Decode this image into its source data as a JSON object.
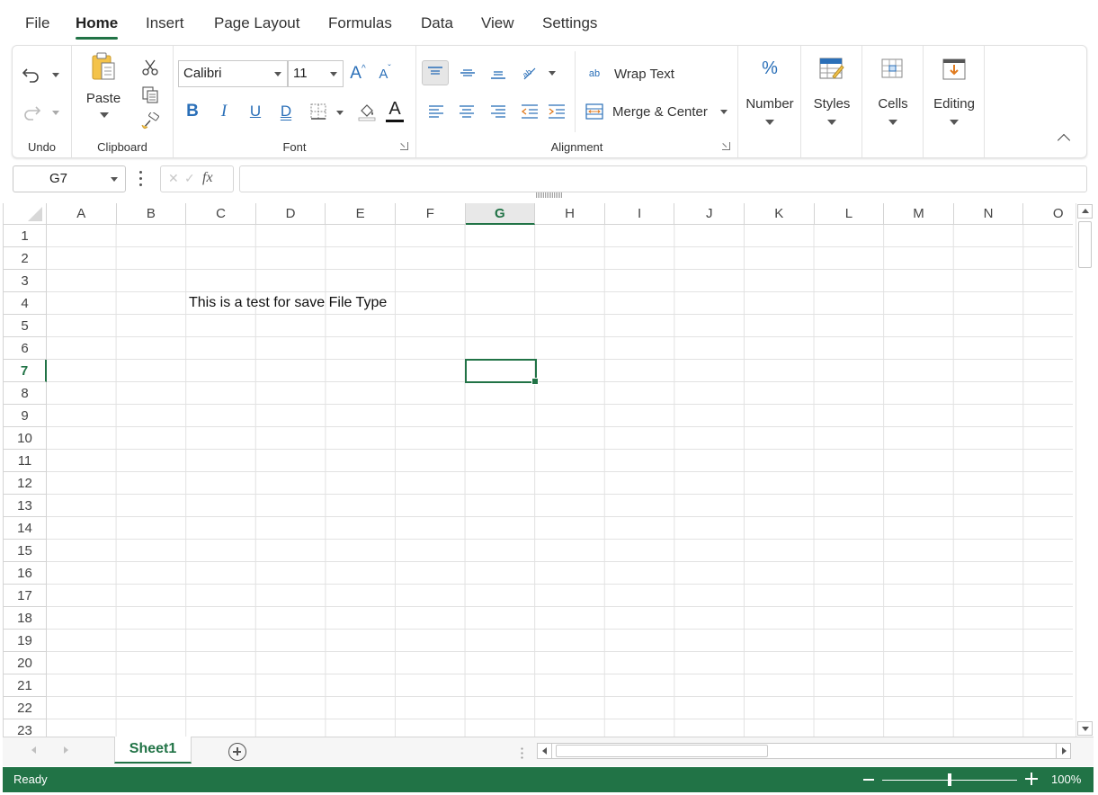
{
  "tabs": [
    {
      "label": "File"
    },
    {
      "label": "Home",
      "active": true
    },
    {
      "label": "Insert"
    },
    {
      "label": "Page Layout"
    },
    {
      "label": "Formulas"
    },
    {
      "label": "Data"
    },
    {
      "label": "View"
    },
    {
      "label": "Settings"
    }
  ],
  "ribbon": {
    "undo_group": {
      "label": "Undo"
    },
    "clipboard": {
      "label": "Clipboard",
      "paste_label": "Paste"
    },
    "font": {
      "label": "Font",
      "family": "Calibri",
      "size": "11",
      "bold_glyph": "B",
      "italic_glyph": "I",
      "underline_glyph": "U",
      "double_underline_glyph": "D",
      "font_color_glyph": "A",
      "grow_glyph": "A",
      "shrink_glyph": "A"
    },
    "alignment": {
      "label": "Alignment",
      "wrap_text": "Wrap Text",
      "merge_center": "Merge & Center",
      "wrap_icon_glyph": "ab"
    },
    "number": {
      "label": "Number",
      "icon_glyph": "%"
    },
    "styles": {
      "label": "Styles"
    },
    "cells": {
      "label": "Cells"
    },
    "editing": {
      "label": "Editing"
    },
    "accent_color": "#217346"
  },
  "formula_bar": {
    "name_box": "G7",
    "fx_label": "fx",
    "cancel_glyph": "✕",
    "enter_glyph": "✓",
    "formula_value": ""
  },
  "grid": {
    "columns": [
      "A",
      "B",
      "C",
      "D",
      "E",
      "F",
      "G",
      "H",
      "I",
      "J",
      "K",
      "L",
      "M",
      "N",
      "O"
    ],
    "rows": [
      "1",
      "2",
      "3",
      "4",
      "5",
      "6",
      "7",
      "8",
      "9",
      "10",
      "11",
      "12",
      "13",
      "14",
      "15",
      "16",
      "17",
      "18",
      "19",
      "20",
      "21",
      "22",
      "23"
    ],
    "selected_column": "G",
    "selected_row": "7",
    "cells": [
      {
        "ref": "C4",
        "value": "This is a test for save File Type"
      }
    ]
  },
  "sheets": [
    {
      "name": "Sheet1",
      "active": true
    }
  ],
  "status": {
    "text": "Ready",
    "zoom": "100%",
    "zoom_fraction": 0.5
  }
}
